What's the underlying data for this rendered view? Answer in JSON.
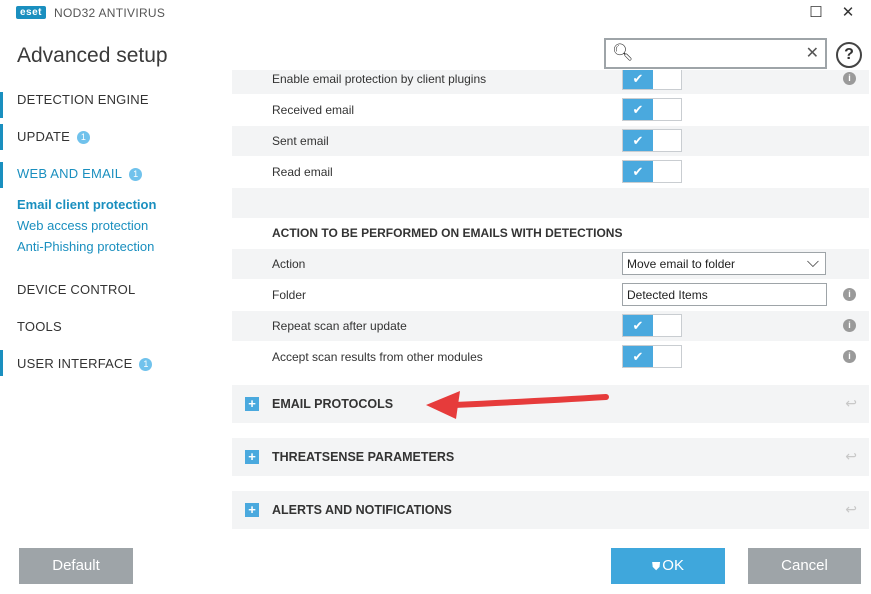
{
  "window": {
    "logo": "eset",
    "app_name": "NOD32 ANTIVIRUS",
    "minimize_icon": "minimize-icon",
    "close_icon": "close-icon"
  },
  "header": {
    "title": "Advanced setup",
    "search_placeholder": "",
    "search_value": "",
    "help_label": "?"
  },
  "sidebar": {
    "items": [
      {
        "label": "DETECTION ENGINE",
        "badge": ""
      },
      {
        "label": "UPDATE",
        "badge": "1"
      },
      {
        "label": "WEB AND EMAIL",
        "badge": "1"
      },
      {
        "label": "DEVICE CONTROL",
        "badge": ""
      },
      {
        "label": "TOOLS",
        "badge": ""
      },
      {
        "label": "USER INTERFACE",
        "badge": "1"
      }
    ],
    "subitems": [
      {
        "label": "Email client protection",
        "selected": true
      },
      {
        "label": "Web access protection",
        "selected": false
      },
      {
        "label": "Anti-Phishing protection",
        "selected": false
      }
    ]
  },
  "main": {
    "client_rows": [
      {
        "label": "Enable email protection by client plugins",
        "value": true
      },
      {
        "label": "Received email",
        "value": true
      },
      {
        "label": "Sent email",
        "value": true
      },
      {
        "label": "Read email",
        "value": true
      }
    ],
    "action_section_title": "ACTION TO BE PERFORMED ON EMAILS WITH DETECTIONS",
    "action": {
      "label": "Action",
      "value": "Move email to folder"
    },
    "folder": {
      "label": "Folder",
      "value": "Detected Items"
    },
    "repeat_scan": {
      "label": "Repeat scan after update",
      "value": true
    },
    "accept_results": {
      "label": "Accept scan results from other modules",
      "value": true
    },
    "collapsed_sections": [
      {
        "title": "EMAIL PROTOCOLS"
      },
      {
        "title": "THREATSENSE PARAMETERS"
      },
      {
        "title": "ALERTS AND NOTIFICATIONS"
      }
    ],
    "toggle_check": "✔",
    "info_glyph": "i",
    "plus_glyph": "+"
  },
  "footer": {
    "default_label": "Default",
    "ok_label": "OK",
    "cancel_label": "Cancel"
  },
  "colors": {
    "accent": "#1a8fbf",
    "toggle_on": "#4aa9de",
    "ok_button": "#3fa7dc",
    "gray_button": "#9ea4a8",
    "arrow": "#e63b3b"
  }
}
